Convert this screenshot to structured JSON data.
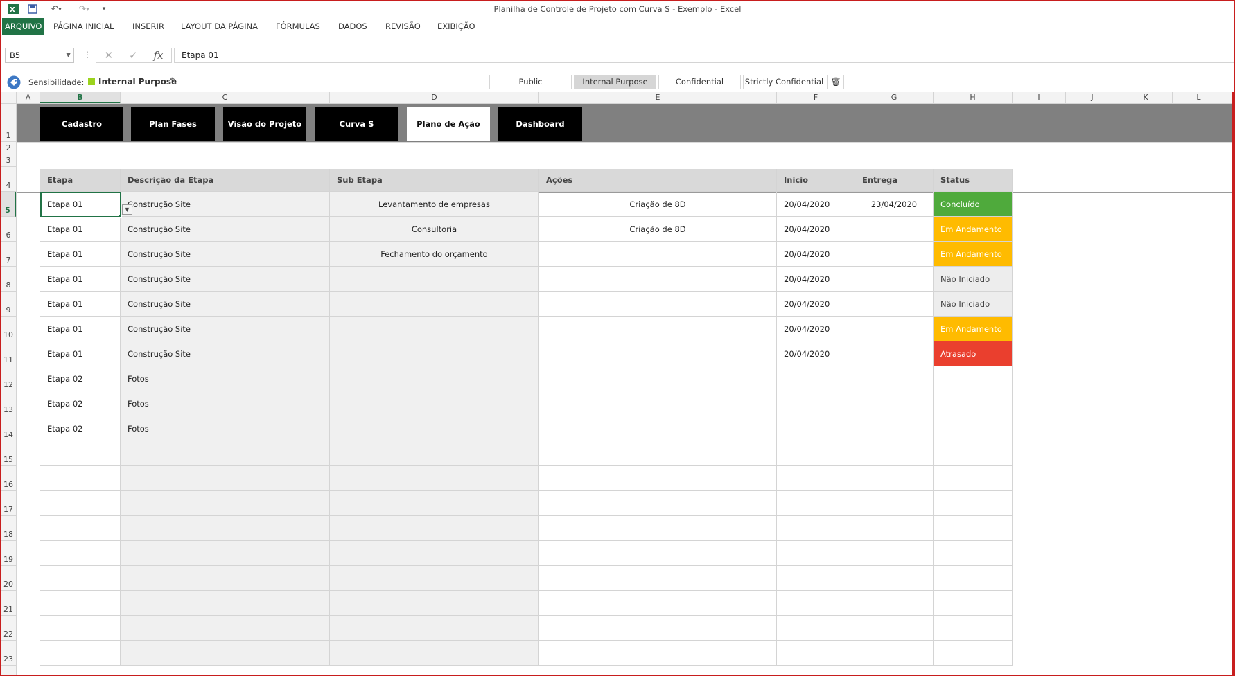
{
  "window": {
    "title": "Planilha de Controle de Projeto com Curva S - Exemplo - Excel"
  },
  "ribbon": {
    "tabs": [
      "ARQUIVO",
      "PÁGINA INICIAL",
      "INSERIR",
      "LAYOUT DA PÁGINA",
      "FÓRMULAS",
      "DADOS",
      "REVISÃO",
      "EXIBIÇÃO"
    ]
  },
  "formula_bar": {
    "name_box": "B5",
    "formula": "Etapa 01",
    "fx_label": "fx"
  },
  "sensitivity": {
    "label": "Sensibilidade:",
    "current": "Internal Purpose",
    "current_color": "#9bd31d",
    "options": [
      "Public",
      "Internal Purpose",
      "Confidential",
      "Strictly Confidential"
    ],
    "active": "Internal Purpose"
  },
  "columns": [
    "A",
    "B",
    "C",
    "D",
    "E",
    "F",
    "G",
    "H",
    "I",
    "J",
    "K",
    "L"
  ],
  "rows": [
    "1",
    "2",
    "3",
    "4",
    "5",
    "6",
    "7",
    "8",
    "9",
    "10",
    "11",
    "12",
    "13",
    "14",
    "15",
    "16",
    "17",
    "18",
    "19",
    "20",
    "21",
    "22",
    "23"
  ],
  "nav": {
    "buttons": [
      "Cadastro",
      "Plan Fases",
      "Visão do Projeto",
      "Curva S",
      "Plano de Ação",
      "Dashboard"
    ],
    "active": "Plano de Ação"
  },
  "table": {
    "headers": [
      "Etapa",
      "Descrição da Etapa",
      "Sub Etapa",
      "Ações",
      "Inicio",
      "Entrega",
      "Status"
    ],
    "rows": [
      {
        "etapa": "Etapa 01",
        "descricao": "Construção Site",
        "sub_etapa": "Levantamento de empresas",
        "acoes": "Criação de 8D",
        "inicio": "20/04/2020",
        "entrega": "23/04/2020",
        "status": "Concluído"
      },
      {
        "etapa": "Etapa 01",
        "descricao": "Construção Site",
        "sub_etapa": "Consultoria",
        "acoes": "Criação de 8D",
        "inicio": "20/04/2020",
        "entrega": "",
        "status": "Em Andamento"
      },
      {
        "etapa": "Etapa 01",
        "descricao": "Construção Site",
        "sub_etapa": "Fechamento do orçamento",
        "acoes": "",
        "inicio": "20/04/2020",
        "entrega": "",
        "status": "Em Andamento"
      },
      {
        "etapa": "Etapa 01",
        "descricao": "Construção Site",
        "sub_etapa": "",
        "acoes": "",
        "inicio": "20/04/2020",
        "entrega": "",
        "status": "Não Iniciado"
      },
      {
        "etapa": "Etapa 01",
        "descricao": "Construção Site",
        "sub_etapa": "",
        "acoes": "",
        "inicio": "20/04/2020",
        "entrega": "",
        "status": "Não Iniciado"
      },
      {
        "etapa": "Etapa 01",
        "descricao": "Construção Site",
        "sub_etapa": "",
        "acoes": "",
        "inicio": "20/04/2020",
        "entrega": "",
        "status": "Em Andamento"
      },
      {
        "etapa": "Etapa 01",
        "descricao": "Construção Site",
        "sub_etapa": "",
        "acoes": "",
        "inicio": "20/04/2020",
        "entrega": "",
        "status": "Atrasado"
      },
      {
        "etapa": "Etapa 02",
        "descricao": "Fotos",
        "sub_etapa": "",
        "acoes": "",
        "inicio": "",
        "entrega": "",
        "status": ""
      },
      {
        "etapa": "Etapa 02",
        "descricao": "Fotos",
        "sub_etapa": "",
        "acoes": "",
        "inicio": "",
        "entrega": "",
        "status": ""
      },
      {
        "etapa": "Etapa 02",
        "descricao": "Fotos",
        "sub_etapa": "",
        "acoes": "",
        "inicio": "",
        "entrega": "",
        "status": ""
      },
      {
        "etapa": "",
        "descricao": "",
        "sub_etapa": "",
        "acoes": "",
        "inicio": "",
        "entrega": "",
        "status": ""
      },
      {
        "etapa": "",
        "descricao": "",
        "sub_etapa": "",
        "acoes": "",
        "inicio": "",
        "entrega": "",
        "status": ""
      },
      {
        "etapa": "",
        "descricao": "",
        "sub_etapa": "",
        "acoes": "",
        "inicio": "",
        "entrega": "",
        "status": ""
      },
      {
        "etapa": "",
        "descricao": "",
        "sub_etapa": "",
        "acoes": "",
        "inicio": "",
        "entrega": "",
        "status": ""
      },
      {
        "etapa": "",
        "descricao": "",
        "sub_etapa": "",
        "acoes": "",
        "inicio": "",
        "entrega": "",
        "status": ""
      },
      {
        "etapa": "",
        "descricao": "",
        "sub_etapa": "",
        "acoes": "",
        "inicio": "",
        "entrega": "",
        "status": ""
      },
      {
        "etapa": "",
        "descricao": "",
        "sub_etapa": "",
        "acoes": "",
        "inicio": "",
        "entrega": "",
        "status": ""
      },
      {
        "etapa": "",
        "descricao": "",
        "sub_etapa": "",
        "acoes": "",
        "inicio": "",
        "entrega": "",
        "status": ""
      },
      {
        "etapa": "",
        "descricao": "",
        "sub_etapa": "",
        "acoes": "",
        "inicio": "",
        "entrega": "",
        "status": ""
      }
    ]
  },
  "status_colors": {
    "Concluído": "#4faa3c",
    "Em Andamento": "#ffbb00",
    "Não Iniciado": "#ededed",
    "Atrasado": "#ea3f2e"
  },
  "icons": {
    "app": "excel-icon",
    "save": "save-icon",
    "undo": "undo-icon",
    "redo": "redo-icon",
    "customize": "customize-qat-icon",
    "sensitivity": "sensitivity-tag-icon",
    "edit": "pencil-icon",
    "delete": "trash-icon",
    "cancel": "cancel-icon",
    "enter": "check-icon",
    "function": "fx-icon",
    "dropdown": "dropdown-arrow-icon"
  }
}
